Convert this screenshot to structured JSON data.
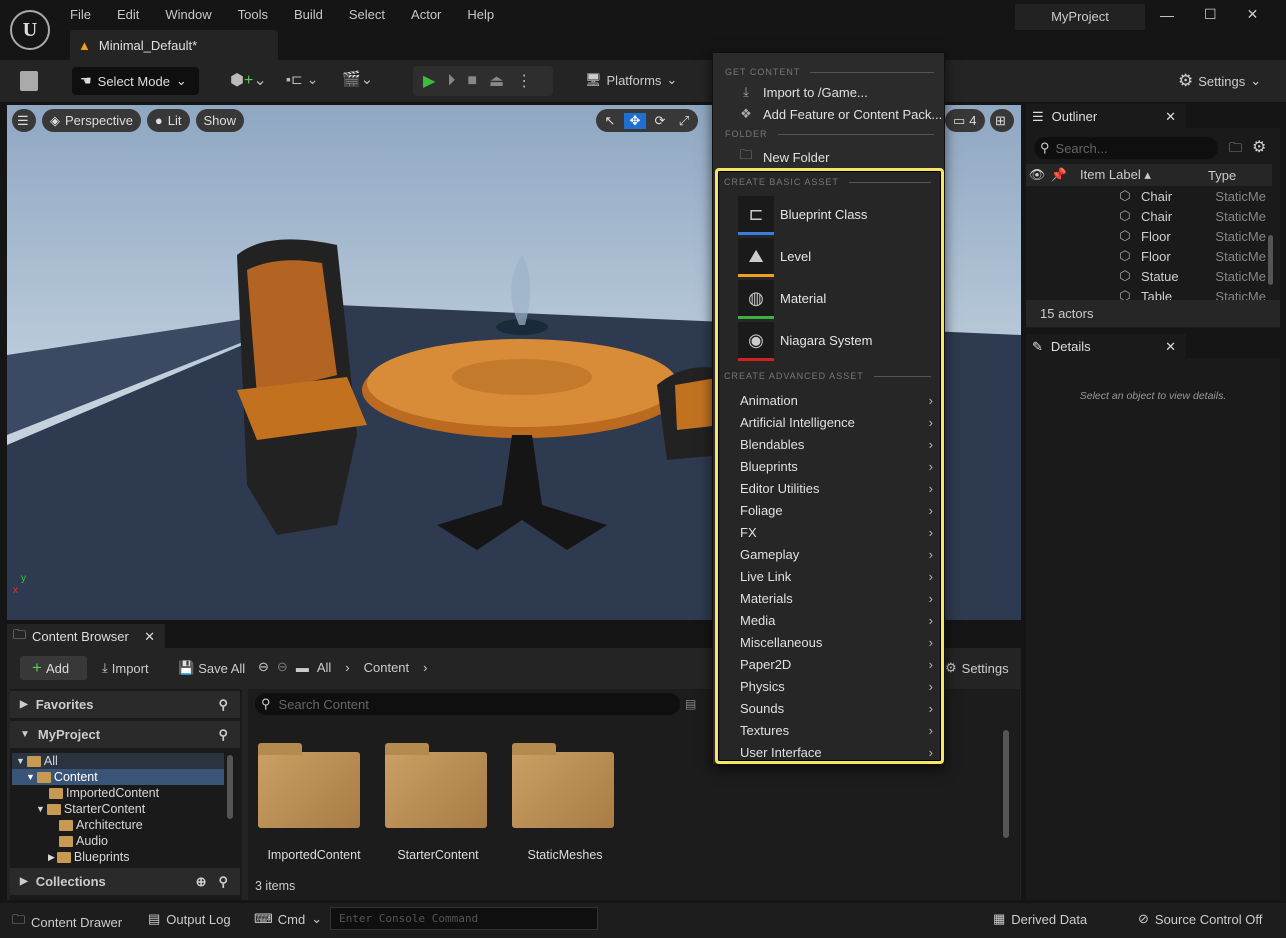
{
  "app": {
    "project": "MyProject",
    "tab": "Minimal_Default*"
  },
  "menu": [
    "File",
    "Edit",
    "Window",
    "Tools",
    "Build",
    "Select",
    "Actor",
    "Help"
  ],
  "toolbar": {
    "select_mode": "Select Mode",
    "platforms": "Platforms",
    "settings": "Settings"
  },
  "viewport": {
    "perspective": "Perspective",
    "lit": "Lit",
    "show": "Show",
    "camera_speed": "4"
  },
  "dropdown": {
    "get_content": "GET CONTENT",
    "import": "Import to /Game...",
    "add_feature": "Add Feature or Content Pack...",
    "folder": "FOLDER",
    "new_folder": "New Folder",
    "basic_header": "CREATE BASIC ASSET",
    "basic": [
      {
        "label": "Blueprint Class",
        "color": "#3a7be0",
        "icon": "blueprint-icon"
      },
      {
        "label": "Level",
        "color": "#f0a020",
        "icon": "level-icon"
      },
      {
        "label": "Material",
        "color": "#3cb043",
        "icon": "material-icon"
      },
      {
        "label": "Niagara System",
        "color": "#d02020",
        "icon": "niagara-icon"
      }
    ],
    "advanced_header": "CREATE ADVANCED ASSET",
    "advanced": [
      "Animation",
      "Artificial Intelligence",
      "Blendables",
      "Blueprints",
      "Editor Utilities",
      "Foliage",
      "FX",
      "Gameplay",
      "Live Link",
      "Materials",
      "Media",
      "Miscellaneous",
      "Paper2D",
      "Physics",
      "Sounds",
      "Textures",
      "User Interface"
    ],
    "highlight_color": "#f5e663"
  },
  "outliner": {
    "title": "Outliner",
    "search_placeholder": "Search...",
    "col_label": "Item Label",
    "col_type": "Type",
    "rows": [
      [
        "Chair",
        "StaticMe"
      ],
      [
        "Chair",
        "StaticMe"
      ],
      [
        "Floor",
        "StaticMe"
      ],
      [
        "Floor",
        "StaticMe"
      ],
      [
        "Statue",
        "StaticMe"
      ],
      [
        "Table",
        "StaticMe"
      ]
    ],
    "count": "15 actors"
  },
  "details": {
    "title": "Details",
    "empty": "Select an object to view details."
  },
  "content_browser": {
    "title": "Content Browser",
    "add": "Add",
    "import": "Import",
    "save_all": "Save All",
    "path": [
      "All",
      "Content"
    ],
    "settings": "Settings",
    "favorites": "Favorites",
    "project": "MyProject",
    "collections": "Collections",
    "tree": [
      "All",
      "Content",
      "ImportedContent",
      "StarterContent",
      "Architecture",
      "Audio",
      "Blueprints"
    ],
    "search_placeholder": "Search Content",
    "items": [
      "ImportedContent",
      "StarterContent",
      "StaticMeshes"
    ],
    "count": "3 items"
  },
  "statusbar": {
    "content_drawer": "Content Drawer",
    "output_log": "Output Log",
    "cmd": "Cmd",
    "console_placeholder": "Enter Console Command",
    "derived_data": "Derived Data",
    "source_control": "Source Control Off"
  }
}
